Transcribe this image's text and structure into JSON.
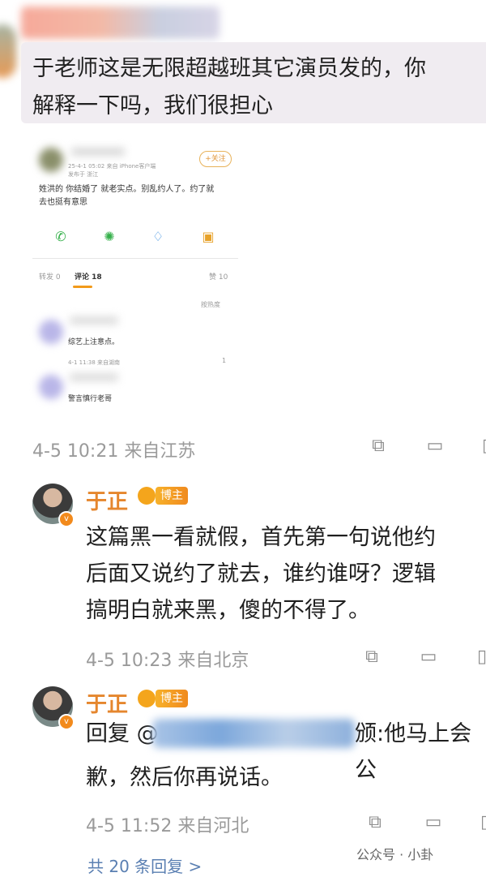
{
  "top_comment": {
    "text": "于老师这是无限超越班其它演员发的，你\n解释一下吗，我们很担心"
  },
  "embedded_post": {
    "meta_line": "25-4-1 05:02  来自 iPhone客户端",
    "location": "发布于 浙江",
    "follow_label": "+关注",
    "text": "姓洪的 你结婚了 就老实点。别乱约人了。约了就\n去也挺有意思",
    "tabs": {
      "repost": "转发 0",
      "comments": "评论 18",
      "likes": "赞 10"
    },
    "sort_label": "按热度",
    "comments": [
      {
        "text": "综艺上注意点。",
        "meta": "4-1 11:38  来自湖南",
        "like_count": "1"
      },
      {
        "text": "警言慎行老哥"
      }
    ]
  },
  "top_comment_meta": "4-5 10:21  来自江苏",
  "replies": [
    {
      "name": "于正",
      "badge": "博主",
      "text": "这篇黑一看就假，首先第一句说他约\n后面又说约了就去，谁约谁呀？逻辑\n搞明白就来黑，傻的不得了。",
      "meta": "4-5 10:23  来自北京"
    },
    {
      "name": "于正",
      "badge": "博主",
      "reply_prefix": "回复 @",
      "reply_suffix": "颁:他马上会公",
      "text_line2": "歉，然后你再说话。",
      "meta": "4-5 11:52  来自河北"
    }
  ],
  "bottom_hint": "共 20 条回复 >",
  "watermark": "公众号 · 小卦"
}
